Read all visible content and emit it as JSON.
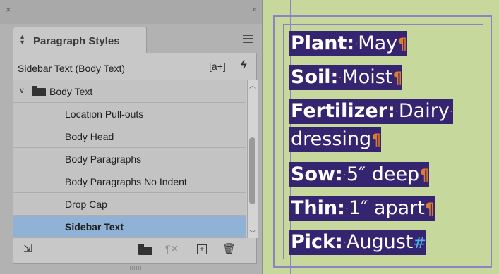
{
  "panel": {
    "close_glyph": "×",
    "collapse_glyph": "‹‹",
    "tab_label": "Paragraph Styles",
    "current_style": "Sidebar Text (Body Text)",
    "new_override_label": "[a+]",
    "lightning_glyph": "ϟ",
    "group": "Body Text",
    "items": [
      "Location Pull-outs",
      "Body Head",
      "Body Paragraphs",
      "Body Paragraphs No Indent",
      "Drop Cap",
      "Sidebar Text"
    ],
    "selected_item": "Sidebar Text",
    "icons": {
      "load": "load-styles-icon",
      "folder": "folder-icon",
      "clear_overrides": "clear-overrides-icon",
      "new_style": "new-style-icon",
      "delete": "trash-icon"
    }
  },
  "document": {
    "lines": [
      {
        "label": "Plant:",
        "value": "May"
      },
      {
        "label": "Soil:",
        "value": "Moist"
      },
      {
        "label": "Fertilizer:",
        "value": "Dairy"
      },
      {
        "label": "",
        "value": "dressing"
      },
      {
        "label": "Sow:",
        "value": "5″ deep"
      },
      {
        "label": "Thin:",
        "value": "1″ apart"
      },
      {
        "label": "Pick:",
        "value": "August"
      }
    ],
    "pilcrow": "¶",
    "end_mark": "#",
    "space_dot": "·"
  },
  "colors": {
    "highlight": "#35246f",
    "selection": "#8fb2d6",
    "page": "#c6d89c",
    "guide": "#8b83c2"
  }
}
